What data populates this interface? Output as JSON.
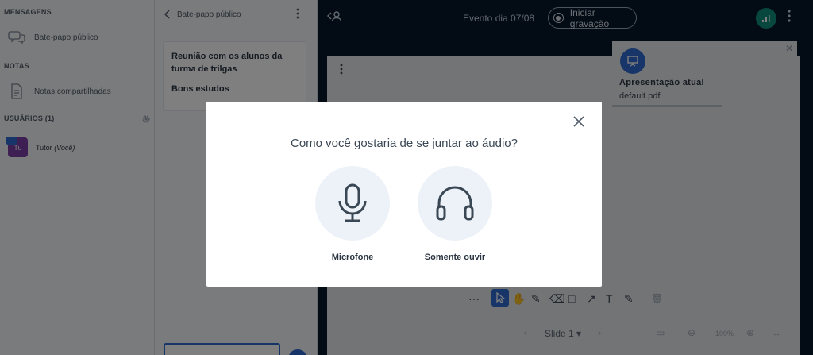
{
  "userlist": {
    "messages_title": "MENSAGENS",
    "public_chat_label": "Bate-papo público",
    "notes_title": "NOTAS",
    "shared_notes_label": "Notas compartilhadas",
    "users_title": "USUÁRIOS (1)",
    "user": {
      "initials": "Tu",
      "name": "Tutor",
      "you_suffix": "(Você)"
    }
  },
  "chat": {
    "title": "Bate-papo público",
    "messages": [
      "Reunião com os alunos da turma de trilgas",
      "Bons estudos"
    ]
  },
  "topbar": {
    "event_title": "Evento dia 07/08",
    "record_label": "Iniciar gravação"
  },
  "presentation": {
    "title": "Apresentação atual",
    "filename": "default.pdf",
    "slide_label": "Slide 1",
    "zoom": "100%"
  },
  "audio_modal": {
    "title": "Como você gostaria de se juntar ao áudio?",
    "microphone_label": "Microfone",
    "listen_only_label": "Somente ouvir"
  },
  "colors": {
    "accent": "#2e6bd1",
    "navbar_bg": "#06172a",
    "connection_ok": "#0f8e7d"
  }
}
